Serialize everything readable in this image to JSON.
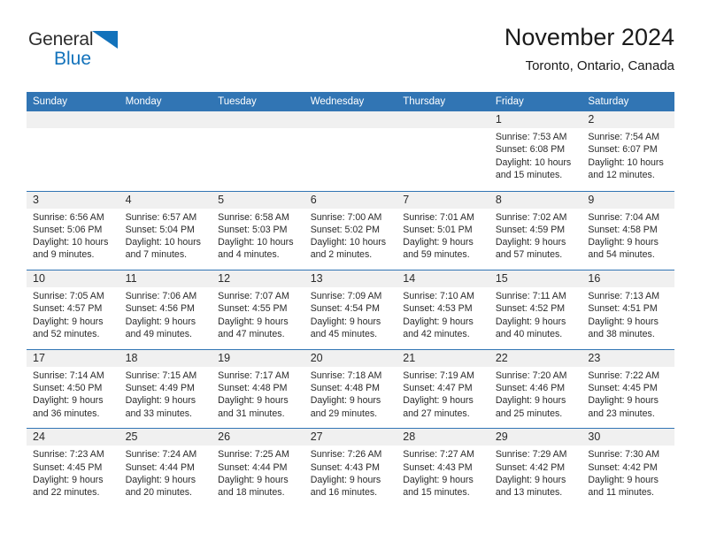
{
  "brand": {
    "name_top": "General",
    "name_bottom": "Blue"
  },
  "header": {
    "title": "November 2024",
    "location": "Toronto, Ontario, Canada"
  },
  "colors": {
    "header_blue": "#3175b4",
    "brand_blue": "#1272bb",
    "daynum_band": "#f0f0f0",
    "text": "#2a2a2a"
  },
  "weekdays": [
    "Sunday",
    "Monday",
    "Tuesday",
    "Wednesday",
    "Thursday",
    "Friday",
    "Saturday"
  ],
  "weeks": [
    [
      {
        "day": "",
        "sunrise": "",
        "sunset": "",
        "daylight": ""
      },
      {
        "day": "",
        "sunrise": "",
        "sunset": "",
        "daylight": ""
      },
      {
        "day": "",
        "sunrise": "",
        "sunset": "",
        "daylight": ""
      },
      {
        "day": "",
        "sunrise": "",
        "sunset": "",
        "daylight": ""
      },
      {
        "day": "",
        "sunrise": "",
        "sunset": "",
        "daylight": ""
      },
      {
        "day": "1",
        "sunrise": "Sunrise: 7:53 AM",
        "sunset": "Sunset: 6:08 PM",
        "daylight": "Daylight: 10 hours and 15 minutes."
      },
      {
        "day": "2",
        "sunrise": "Sunrise: 7:54 AM",
        "sunset": "Sunset: 6:07 PM",
        "daylight": "Daylight: 10 hours and 12 minutes."
      }
    ],
    [
      {
        "day": "3",
        "sunrise": "Sunrise: 6:56 AM",
        "sunset": "Sunset: 5:06 PM",
        "daylight": "Daylight: 10 hours and 9 minutes."
      },
      {
        "day": "4",
        "sunrise": "Sunrise: 6:57 AM",
        "sunset": "Sunset: 5:04 PM",
        "daylight": "Daylight: 10 hours and 7 minutes."
      },
      {
        "day": "5",
        "sunrise": "Sunrise: 6:58 AM",
        "sunset": "Sunset: 5:03 PM",
        "daylight": "Daylight: 10 hours and 4 minutes."
      },
      {
        "day": "6",
        "sunrise": "Sunrise: 7:00 AM",
        "sunset": "Sunset: 5:02 PM",
        "daylight": "Daylight: 10 hours and 2 minutes."
      },
      {
        "day": "7",
        "sunrise": "Sunrise: 7:01 AM",
        "sunset": "Sunset: 5:01 PM",
        "daylight": "Daylight: 9 hours and 59 minutes."
      },
      {
        "day": "8",
        "sunrise": "Sunrise: 7:02 AM",
        "sunset": "Sunset: 4:59 PM",
        "daylight": "Daylight: 9 hours and 57 minutes."
      },
      {
        "day": "9",
        "sunrise": "Sunrise: 7:04 AM",
        "sunset": "Sunset: 4:58 PM",
        "daylight": "Daylight: 9 hours and 54 minutes."
      }
    ],
    [
      {
        "day": "10",
        "sunrise": "Sunrise: 7:05 AM",
        "sunset": "Sunset: 4:57 PM",
        "daylight": "Daylight: 9 hours and 52 minutes."
      },
      {
        "day": "11",
        "sunrise": "Sunrise: 7:06 AM",
        "sunset": "Sunset: 4:56 PM",
        "daylight": "Daylight: 9 hours and 49 minutes."
      },
      {
        "day": "12",
        "sunrise": "Sunrise: 7:07 AM",
        "sunset": "Sunset: 4:55 PM",
        "daylight": "Daylight: 9 hours and 47 minutes."
      },
      {
        "day": "13",
        "sunrise": "Sunrise: 7:09 AM",
        "sunset": "Sunset: 4:54 PM",
        "daylight": "Daylight: 9 hours and 45 minutes."
      },
      {
        "day": "14",
        "sunrise": "Sunrise: 7:10 AM",
        "sunset": "Sunset: 4:53 PM",
        "daylight": "Daylight: 9 hours and 42 minutes."
      },
      {
        "day": "15",
        "sunrise": "Sunrise: 7:11 AM",
        "sunset": "Sunset: 4:52 PM",
        "daylight": "Daylight: 9 hours and 40 minutes."
      },
      {
        "day": "16",
        "sunrise": "Sunrise: 7:13 AM",
        "sunset": "Sunset: 4:51 PM",
        "daylight": "Daylight: 9 hours and 38 minutes."
      }
    ],
    [
      {
        "day": "17",
        "sunrise": "Sunrise: 7:14 AM",
        "sunset": "Sunset: 4:50 PM",
        "daylight": "Daylight: 9 hours and 36 minutes."
      },
      {
        "day": "18",
        "sunrise": "Sunrise: 7:15 AM",
        "sunset": "Sunset: 4:49 PM",
        "daylight": "Daylight: 9 hours and 33 minutes."
      },
      {
        "day": "19",
        "sunrise": "Sunrise: 7:17 AM",
        "sunset": "Sunset: 4:48 PM",
        "daylight": "Daylight: 9 hours and 31 minutes."
      },
      {
        "day": "20",
        "sunrise": "Sunrise: 7:18 AM",
        "sunset": "Sunset: 4:48 PM",
        "daylight": "Daylight: 9 hours and 29 minutes."
      },
      {
        "day": "21",
        "sunrise": "Sunrise: 7:19 AM",
        "sunset": "Sunset: 4:47 PM",
        "daylight": "Daylight: 9 hours and 27 minutes."
      },
      {
        "day": "22",
        "sunrise": "Sunrise: 7:20 AM",
        "sunset": "Sunset: 4:46 PM",
        "daylight": "Daylight: 9 hours and 25 minutes."
      },
      {
        "day": "23",
        "sunrise": "Sunrise: 7:22 AM",
        "sunset": "Sunset: 4:45 PM",
        "daylight": "Daylight: 9 hours and 23 minutes."
      }
    ],
    [
      {
        "day": "24",
        "sunrise": "Sunrise: 7:23 AM",
        "sunset": "Sunset: 4:45 PM",
        "daylight": "Daylight: 9 hours and 22 minutes."
      },
      {
        "day": "25",
        "sunrise": "Sunrise: 7:24 AM",
        "sunset": "Sunset: 4:44 PM",
        "daylight": "Daylight: 9 hours and 20 minutes."
      },
      {
        "day": "26",
        "sunrise": "Sunrise: 7:25 AM",
        "sunset": "Sunset: 4:44 PM",
        "daylight": "Daylight: 9 hours and 18 minutes."
      },
      {
        "day": "27",
        "sunrise": "Sunrise: 7:26 AM",
        "sunset": "Sunset: 4:43 PM",
        "daylight": "Daylight: 9 hours and 16 minutes."
      },
      {
        "day": "28",
        "sunrise": "Sunrise: 7:27 AM",
        "sunset": "Sunset: 4:43 PM",
        "daylight": "Daylight: 9 hours and 15 minutes."
      },
      {
        "day": "29",
        "sunrise": "Sunrise: 7:29 AM",
        "sunset": "Sunset: 4:42 PM",
        "daylight": "Daylight: 9 hours and 13 minutes."
      },
      {
        "day": "30",
        "sunrise": "Sunrise: 7:30 AM",
        "sunset": "Sunset: 4:42 PM",
        "daylight": "Daylight: 9 hours and 11 minutes."
      }
    ]
  ]
}
